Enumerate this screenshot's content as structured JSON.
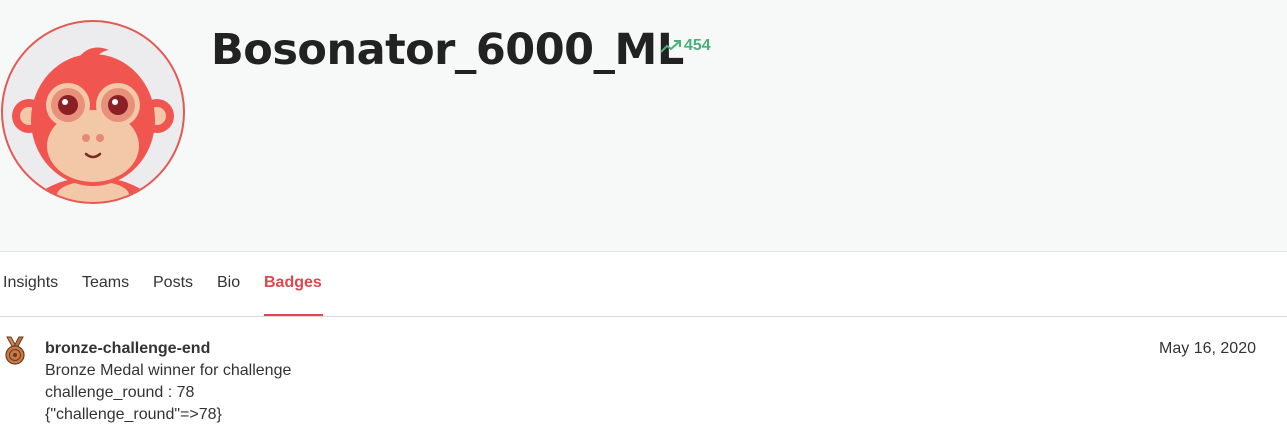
{
  "profile": {
    "username": "Bosonator_6000_ML",
    "score": "454",
    "avatar_icon": "monkey-avatar-icon",
    "score_icon": "trending-up-icon"
  },
  "tabs": [
    {
      "label": "Insights",
      "active": false
    },
    {
      "label": "Teams",
      "active": false
    },
    {
      "label": "Posts",
      "active": false
    },
    {
      "label": "Bio",
      "active": false
    },
    {
      "label": "Badges",
      "active": true
    }
  ],
  "badges": [
    {
      "icon": "bronze-medal-icon",
      "title": "bronze-challenge-end",
      "description": "Bronze Medal winner for challenge",
      "detail": "challenge_round : 78",
      "raw": "{\"challenge_round\"=>78}",
      "date": "May 16, 2020"
    }
  ],
  "colors": {
    "accent": "#e0474c",
    "score_green": "#46b27a",
    "header_bg": "#f7f8f8",
    "avatar_red": "#f0554f"
  }
}
